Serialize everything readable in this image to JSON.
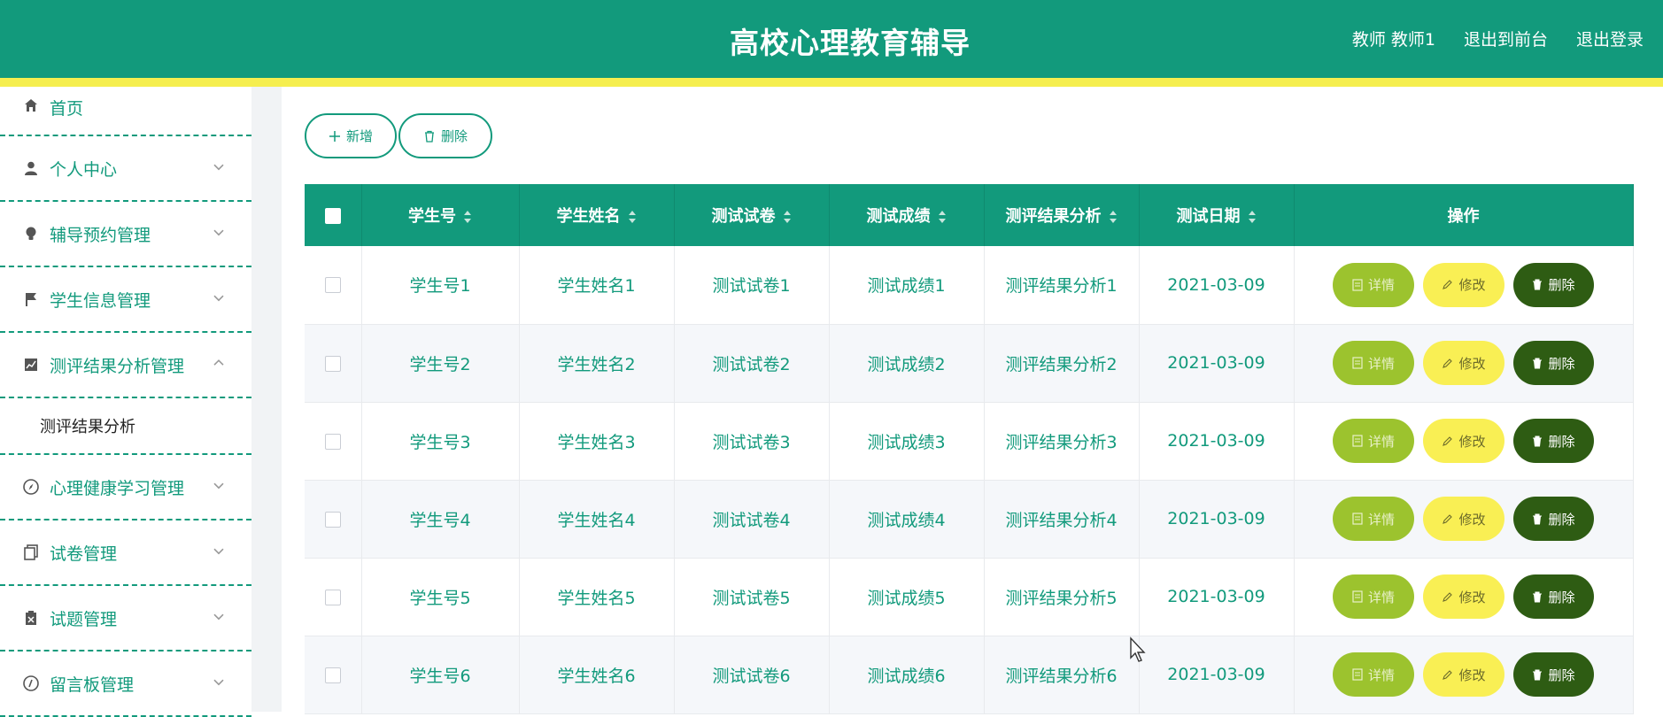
{
  "header": {
    "title": "高校心理教育辅导",
    "user": "教师 教师1",
    "to_front": "退出到前台",
    "logout": "退出登录"
  },
  "sidebar": {
    "items": [
      {
        "label": "首页",
        "icon": "home-icon"
      },
      {
        "label": "个人中心",
        "icon": "user-icon"
      },
      {
        "label": "辅导预约管理",
        "icon": "bulb-icon"
      },
      {
        "label": "学生信息管理",
        "icon": "flag-icon"
      },
      {
        "label": "测评结果分析管理",
        "icon": "chart-icon",
        "expanded": true
      },
      {
        "label": "测评结果分析",
        "submenu": true
      },
      {
        "label": "心理健康学习管理",
        "icon": "compass-icon"
      },
      {
        "label": "试卷管理",
        "icon": "copy-icon"
      },
      {
        "label": "试题管理",
        "icon": "clipboard-icon"
      },
      {
        "label": "留言板管理",
        "icon": "circle-icon"
      }
    ]
  },
  "toolbar": {
    "add_label": "新增",
    "delete_label": "删除"
  },
  "table": {
    "columns": [
      "学生号",
      "学生姓名",
      "测试试卷",
      "测试成绩",
      "测评结果分析",
      "测试日期",
      "操作"
    ],
    "rows": [
      [
        "学生号1",
        "学生姓名1",
        "测试试卷1",
        "测试成绩1",
        "测评结果分析1",
        "2021-03-09"
      ],
      [
        "学生号2",
        "学生姓名2",
        "测试试卷2",
        "测试成绩2",
        "测评结果分析2",
        "2021-03-09"
      ],
      [
        "学生号3",
        "学生姓名3",
        "测试试卷3",
        "测试成绩3",
        "测评结果分析3",
        "2021-03-09"
      ],
      [
        "学生号4",
        "学生姓名4",
        "测试试卷4",
        "测试成绩4",
        "测评结果分析4",
        "2021-03-09"
      ],
      [
        "学生号5",
        "学生姓名5",
        "测试试卷5",
        "测试成绩5",
        "测评结果分析5",
        "2021-03-09"
      ],
      [
        "学生号6",
        "学生姓名6",
        "测试试卷6",
        "测试成绩6",
        "测评结果分析6",
        "2021-03-09"
      ]
    ],
    "ops": {
      "detail": "详情",
      "edit": "修改",
      "remove": "删除"
    }
  },
  "colors": {
    "primary": "#129a7c",
    "stripe": "#f5ee4f",
    "detail": "#9cc32e",
    "edit": "#f9ef54",
    "remove": "#2e5c13"
  }
}
